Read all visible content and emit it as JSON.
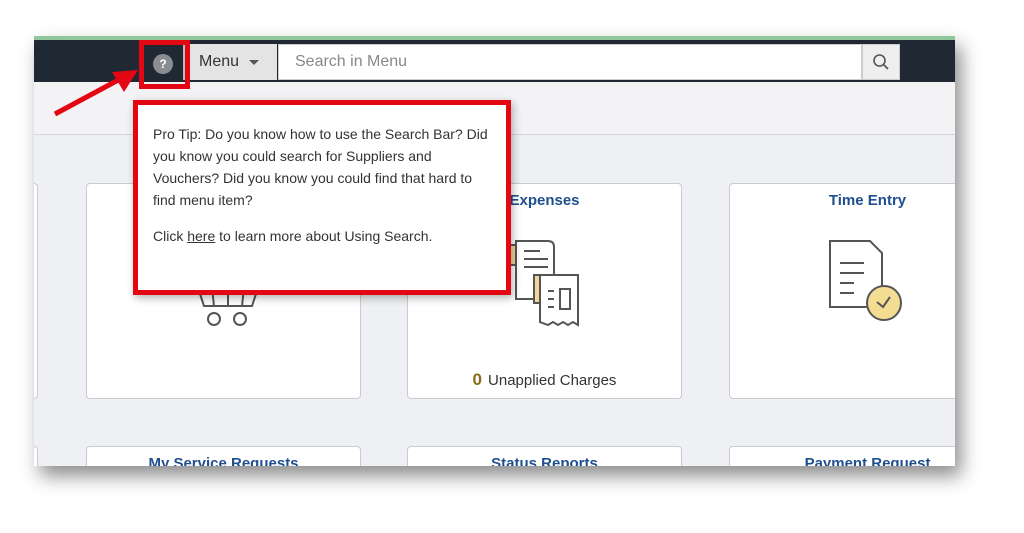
{
  "header": {
    "help_icon_label": "?",
    "menu_label": "Menu",
    "search_placeholder": "Search in Menu"
  },
  "popover": {
    "line1": "Pro Tip: Do you know how to use the Search Bar? Did you know you could search for Suppliers and Vouchers? Did you know you could find that hard to find menu item?",
    "click_prefix": "Click ",
    "link": "here",
    "click_suffix": " to learn more about Using Search."
  },
  "tiles": [
    {
      "title": "Expenses",
      "count": "0",
      "count_label": "Unapplied Charges"
    },
    {
      "title": "Time Entry"
    },
    {
      "title": "My Service Requests"
    },
    {
      "title": "Status Reports"
    },
    {
      "title": "Payment Request"
    }
  ],
  "colors": {
    "highlight": "#e30613",
    "tile_title": "#1f4f8f",
    "topbar": "#1f2833"
  }
}
